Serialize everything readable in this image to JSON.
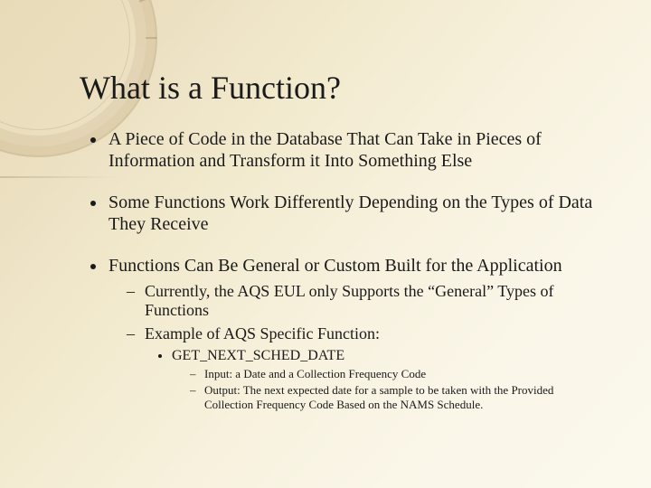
{
  "title": "What is a Function?",
  "bullets": {
    "b1": "A Piece of Code in the Database That Can Take in Pieces of Information and Transform it Into Something Else",
    "b2": "Some Functions Work Differently Depending on the Types of Data They Receive",
    "b3": "Functions Can Be General or Custom Built for the Application",
    "b3_sub": {
      "s1": "Currently, the AQS EUL only Supports the “General” Types of Functions",
      "s2": "Example of AQS Specific Function:",
      "s2_sub": {
        "fn": "GET_NEXT_SCHED_DATE",
        "io": {
          "input": "Input:  a Date and a Collection Frequency Code",
          "output": "Output:  The next expected date for a sample to be taken with the Provided Collection Frequency Code Based on the NAMS Schedule."
        }
      }
    }
  }
}
